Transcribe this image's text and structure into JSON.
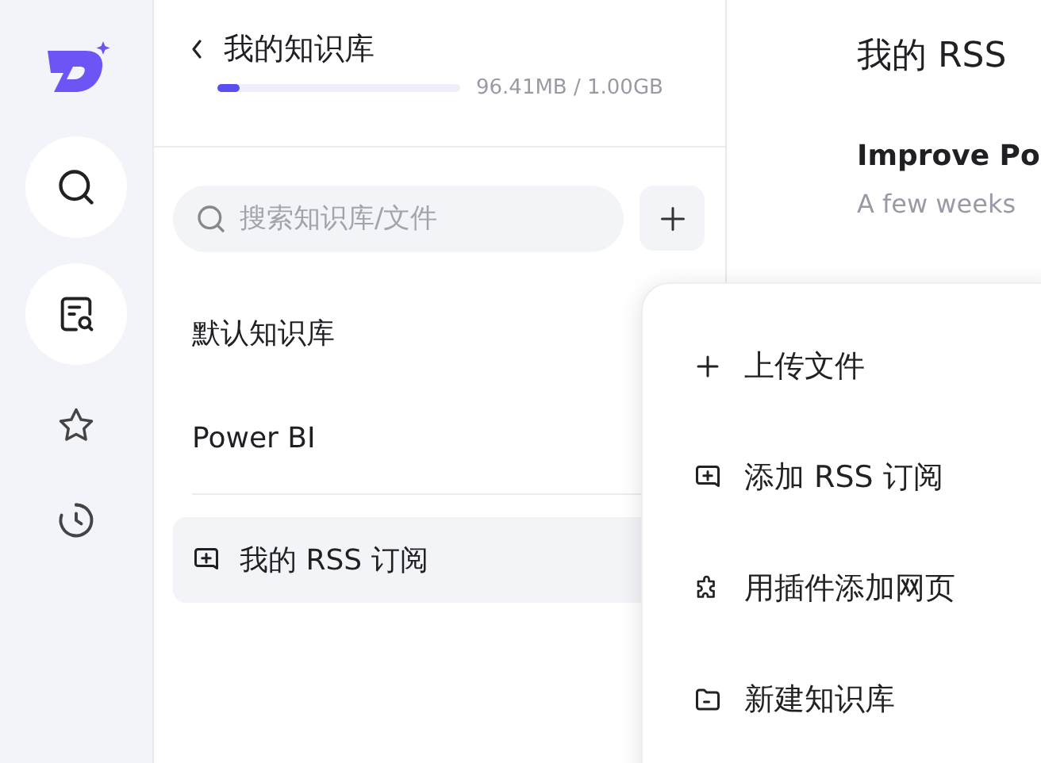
{
  "rail": {
    "items": [
      {
        "kind": "search",
        "highlighted": true
      },
      {
        "kind": "doc-search",
        "highlighted": true
      },
      {
        "kind": "star",
        "highlighted": false
      },
      {
        "kind": "history",
        "highlighted": false
      }
    ]
  },
  "library": {
    "title": "我的知识库",
    "storage": {
      "level": 0.09,
      "reading": "96.41MB / 1.00GB"
    },
    "search": {
      "placeholder": "搜索知识库/文件"
    },
    "items": [
      {
        "kind": "library",
        "label": "默认知识库",
        "selected": false
      },
      {
        "kind": "library",
        "label": "Power BI",
        "selected": false
      },
      {
        "kind": "feed",
        "label": "我的 RSS 订阅",
        "selected": true
      }
    ]
  },
  "feed": {
    "title": "我的 RSS",
    "article": {
      "title": "Improve Po",
      "time": "A few weeks"
    }
  },
  "menu": {
    "items": [
      {
        "kind": "plus",
        "label": "上传文件"
      },
      {
        "kind": "plus-square",
        "label": "添加 RSS 订阅"
      },
      {
        "kind": "puzzle",
        "label": "用插件添加网页"
      },
      {
        "kind": "folder",
        "label": "新建知识库"
      }
    ]
  }
}
